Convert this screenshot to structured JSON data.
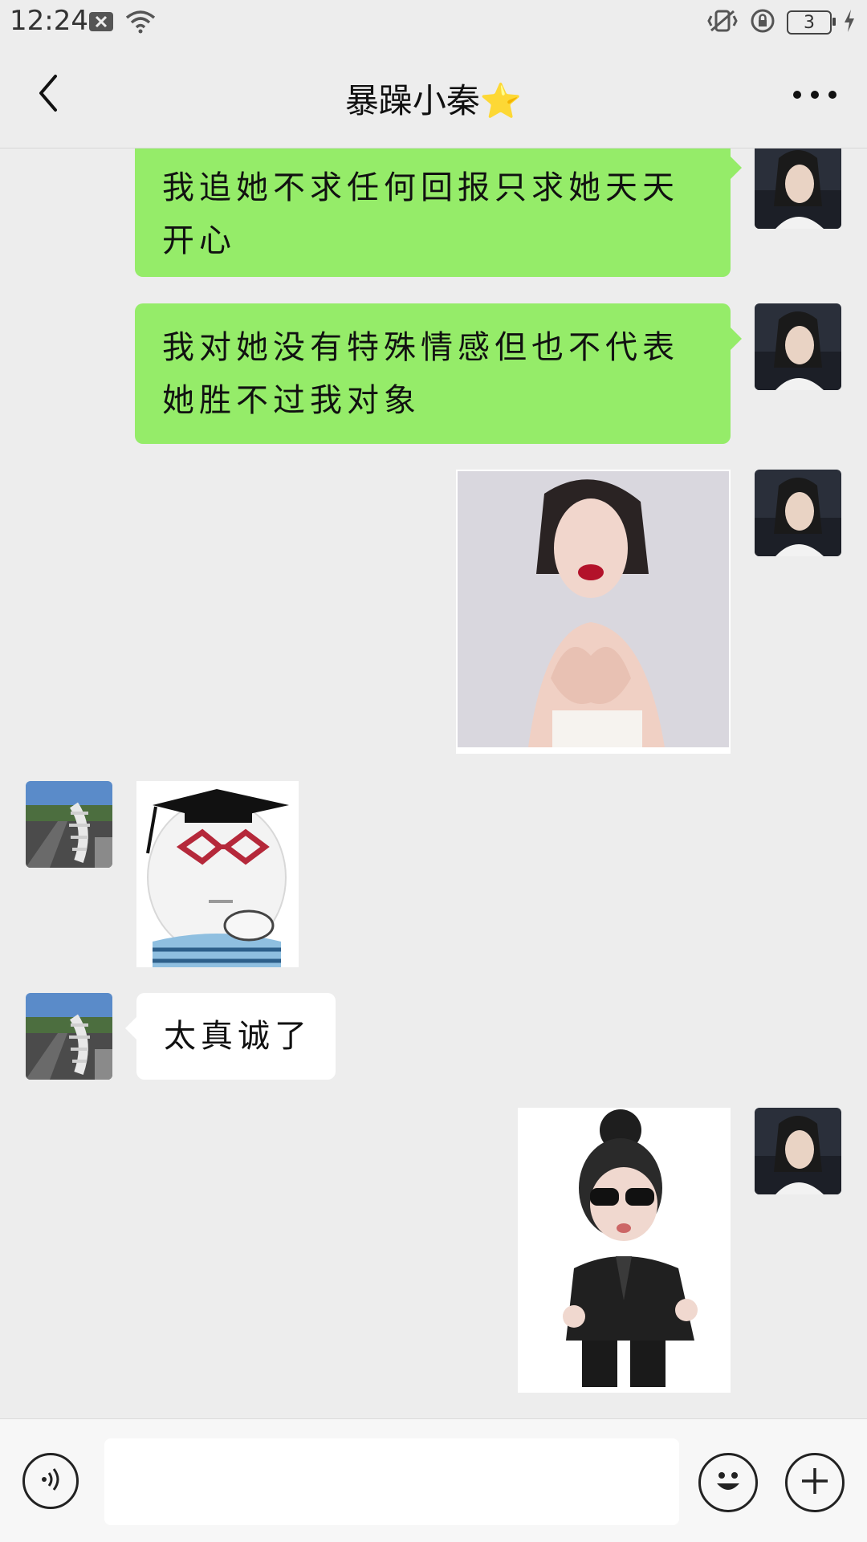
{
  "status_bar": {
    "time": "12:24",
    "battery_level": "3",
    "icons": [
      "close-box-icon",
      "wifi-icon",
      "vibrate-icon",
      "rotation-lock-icon",
      "battery-icon",
      "charging-icon"
    ]
  },
  "header": {
    "title": "暴躁小秦⭐",
    "back_icon": "chevron-left-icon",
    "more_icon": "more-dots-icon"
  },
  "messages": [
    {
      "sender": "me",
      "type": "text",
      "text": "我追她不求任何回报只求她天天开心"
    },
    {
      "sender": "me",
      "type": "text",
      "text": "我对她没有特殊情感但也不代表她胜不过我对象"
    },
    {
      "sender": "me",
      "type": "image",
      "image": "photo-woman-heart-hands"
    },
    {
      "sender": "other",
      "type": "image",
      "image": "sticker-graduate-cap-glasses"
    },
    {
      "sender": "other",
      "type": "text",
      "text": "太真诚了"
    },
    {
      "sender": "me",
      "type": "image",
      "image": "sticker-sunglasses-suit"
    }
  ],
  "input_bar": {
    "voice_icon": "voice-icon",
    "input_value": "",
    "emoji_icon": "emoji-icon",
    "plus_icon": "plus-icon"
  },
  "colors": {
    "background": "#ededed",
    "my_bubble": "#95ec69",
    "other_bubble": "#ffffff"
  }
}
